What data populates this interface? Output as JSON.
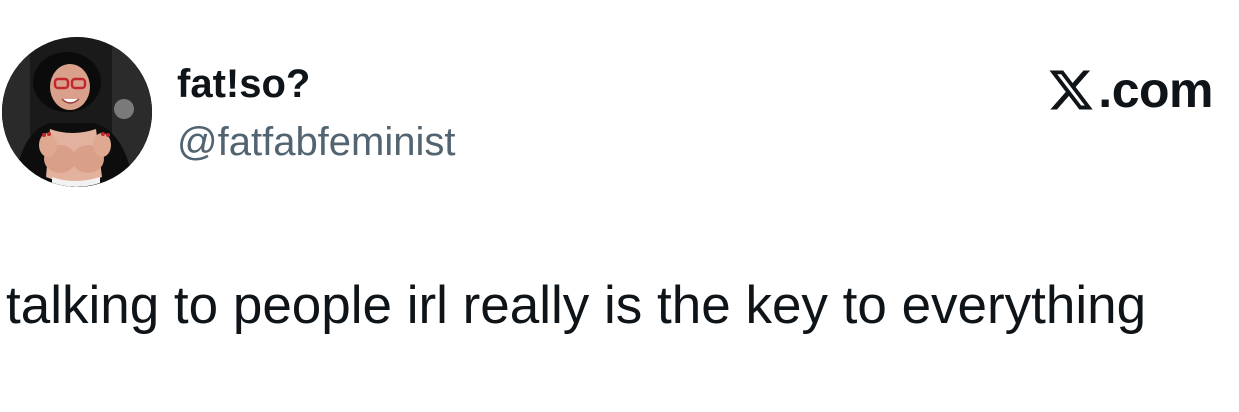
{
  "author": {
    "display_name": "fat!so?",
    "handle": "@fatfabfeminist",
    "avatar_icon": "profile-photo"
  },
  "brand": {
    "icon": "x-logo-icon",
    "domain_suffix": ".com"
  },
  "tweet": {
    "text": "talking to people irl really is the key to everything"
  },
  "colors": {
    "text_primary": "#0f1419",
    "text_secondary": "#536471",
    "background": "#ffffff"
  }
}
